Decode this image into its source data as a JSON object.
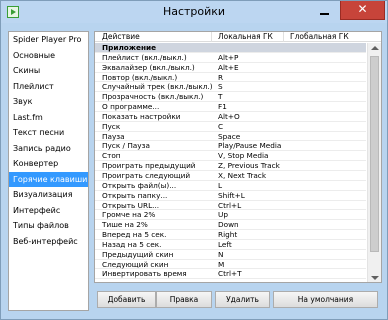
{
  "window": {
    "title": "Настройки",
    "close_glyph": "✕"
  },
  "sidebar": {
    "items": [
      {
        "label": "Spider Player Pro",
        "selected": false
      },
      {
        "label": "Основные",
        "selected": false
      },
      {
        "label": "Скины",
        "selected": false
      },
      {
        "label": "Плейлист",
        "selected": false
      },
      {
        "label": "Звук",
        "selected": false
      },
      {
        "label": "Last.fm",
        "selected": false
      },
      {
        "label": "Текст песни",
        "selected": false
      },
      {
        "label": "Запись радио",
        "selected": false
      },
      {
        "label": "Конвертер",
        "selected": false
      },
      {
        "label": "Горячие клавиши",
        "selected": true
      },
      {
        "label": "Визуализация",
        "selected": false
      },
      {
        "label": "Интерфейс",
        "selected": false
      },
      {
        "label": "Типы файлов",
        "selected": false
      },
      {
        "label": "Веб-интерфейс",
        "selected": false
      }
    ]
  },
  "table": {
    "columns": [
      "Действие",
      "Локальная ГК",
      "Глобальная ГК"
    ],
    "rows": [
      {
        "action": "Приложение",
        "local": "",
        "group": true
      },
      {
        "action": "Плейлист (вкл./выкл.)",
        "local": "Alt+P"
      },
      {
        "action": "Эквалайзер (вкл./выкл.)",
        "local": "Alt+E"
      },
      {
        "action": "Повтор (вкл./выкл.)",
        "local": "R"
      },
      {
        "action": "Случайный трек (вкл./выкл.)",
        "local": "S"
      },
      {
        "action": "Прозрачность (вкл./выкл.)",
        "local": "T"
      },
      {
        "action": "О программе...",
        "local": "F1"
      },
      {
        "action": "Показать настройки",
        "local": "Alt+O"
      },
      {
        "action": "Пуск",
        "local": "C"
      },
      {
        "action": "Пауза",
        "local": "Space"
      },
      {
        "action": "Пуск / Пауза",
        "local": "Play/Pause Media"
      },
      {
        "action": "Стоп",
        "local": "V, Stop Media"
      },
      {
        "action": "Проиграть предыдущий",
        "local": "Z, Previous Track"
      },
      {
        "action": "Проиграть следующий",
        "local": "X, Next Track"
      },
      {
        "action": "Открыть файл(ы)...",
        "local": "L"
      },
      {
        "action": "Открыть папку...",
        "local": "Shift+L"
      },
      {
        "action": "Открыть URL...",
        "local": "Ctrl+L"
      },
      {
        "action": "Громче на 2%",
        "local": "Up"
      },
      {
        "action": "Тише на 2%",
        "local": "Down"
      },
      {
        "action": "Вперед на 5 сек.",
        "local": "Right"
      },
      {
        "action": "Назад на 5 сек.",
        "local": "Left"
      },
      {
        "action": "Предыдущий скин",
        "local": "N"
      },
      {
        "action": "Следующий скин",
        "local": "M"
      },
      {
        "action": "Инвертировать время",
        "local": "Ctrl+T"
      }
    ]
  },
  "buttons": {
    "add": "Добавить",
    "edit": "Правка",
    "delete": "Удалить",
    "defaults": "На умолчания"
  }
}
